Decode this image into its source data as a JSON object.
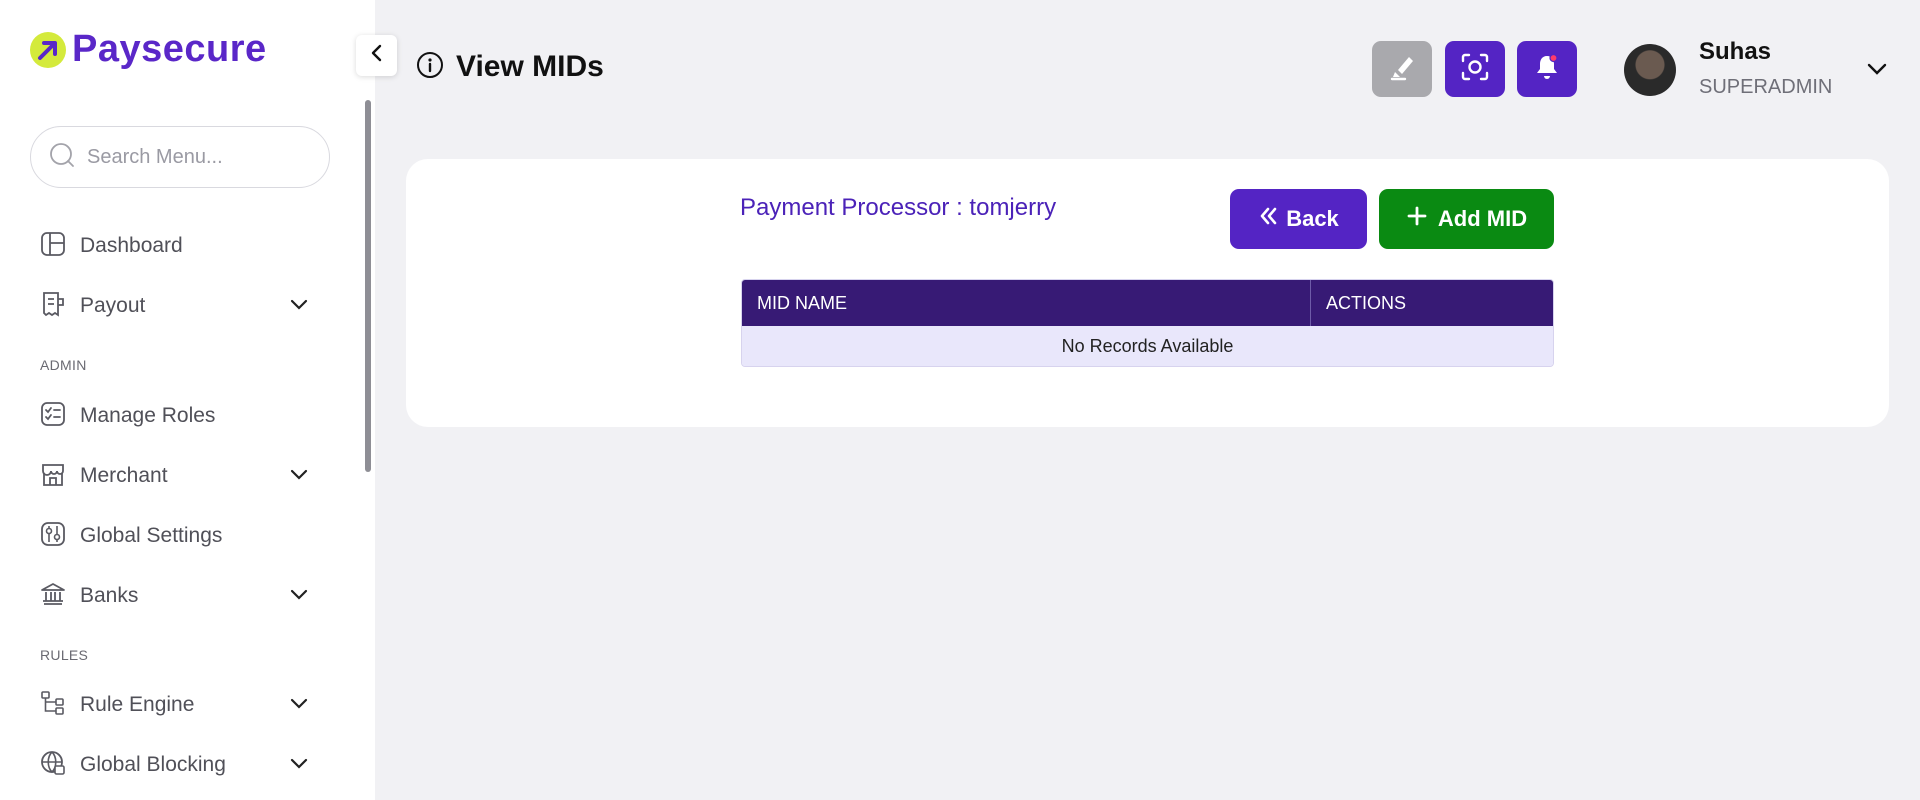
{
  "brand": {
    "name": "Paysecure"
  },
  "sidebar": {
    "search_placeholder": "Search Menu...",
    "items": [
      {
        "label": "Dashboard",
        "icon": "dashboard-icon"
      },
      {
        "label": "Payout",
        "icon": "receipt-icon"
      },
      {
        "label": "Manage Roles",
        "icon": "checklist-icon"
      },
      {
        "label": "Merchant",
        "icon": "store-icon"
      },
      {
        "label": "Global Settings",
        "icon": "settings-sliders-icon"
      },
      {
        "label": "Banks",
        "icon": "bank-icon"
      },
      {
        "label": "Rule Engine",
        "icon": "hierarchy-icon"
      },
      {
        "label": "Global Blocking",
        "icon": "globe-block-icon"
      }
    ],
    "sections": {
      "admin": "ADMIN",
      "rules": "RULES"
    }
  },
  "header": {
    "title": "View MIDs",
    "user": {
      "name": "Suhas",
      "role": "SUPERADMIN"
    }
  },
  "content": {
    "processor_label": "Payment Processor : ",
    "processor_name": "tomjerry",
    "back_label": "Back",
    "add_label": "Add MID",
    "table": {
      "columns": [
        "MID NAME",
        "ACTIONS"
      ],
      "empty_message": "No Records Available"
    }
  },
  "colors": {
    "brand": "#5424c4",
    "accent": "#d4ea3c",
    "success": "#0a8a12",
    "table_header": "#371a75"
  }
}
